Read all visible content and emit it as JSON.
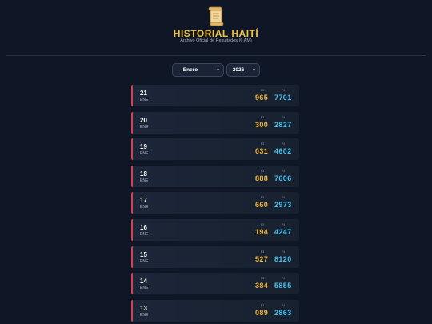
{
  "header": {
    "icon": "scroll-icon",
    "title": "HISTORIAL HAITÍ",
    "subtitle": "Archivo Oficial de Resultados (6 AM)"
  },
  "filters": {
    "month": "Enero",
    "year": "2026"
  },
  "results": {
    "p3_label": "P3",
    "p4_label": "P4",
    "rows": [
      {
        "day": "21",
        "month": "ENE",
        "p3": "965",
        "p4": "7701"
      },
      {
        "day": "20",
        "month": "ENE",
        "p3": "300",
        "p4": "2827"
      },
      {
        "day": "19",
        "month": "ENE",
        "p3": "031",
        "p4": "4602"
      },
      {
        "day": "18",
        "month": "ENE",
        "p3": "888",
        "p4": "7606"
      },
      {
        "day": "17",
        "month": "ENE",
        "p3": "660",
        "p4": "2973"
      },
      {
        "day": "16",
        "month": "ENE",
        "p3": "194",
        "p4": "4247"
      },
      {
        "day": "15",
        "month": "ENE",
        "p3": "527",
        "p4": "8120"
      },
      {
        "day": "14",
        "month": "ENE",
        "p3": "384",
        "p4": "5855"
      },
      {
        "day": "13",
        "month": "ENE",
        "p3": "089",
        "p4": "2863"
      }
    ]
  },
  "colors": {
    "background": "#0f1726",
    "title": "#f3c23f",
    "p3": "#f2b73a",
    "p4": "#46c2ee",
    "accent": "#d9414f"
  }
}
